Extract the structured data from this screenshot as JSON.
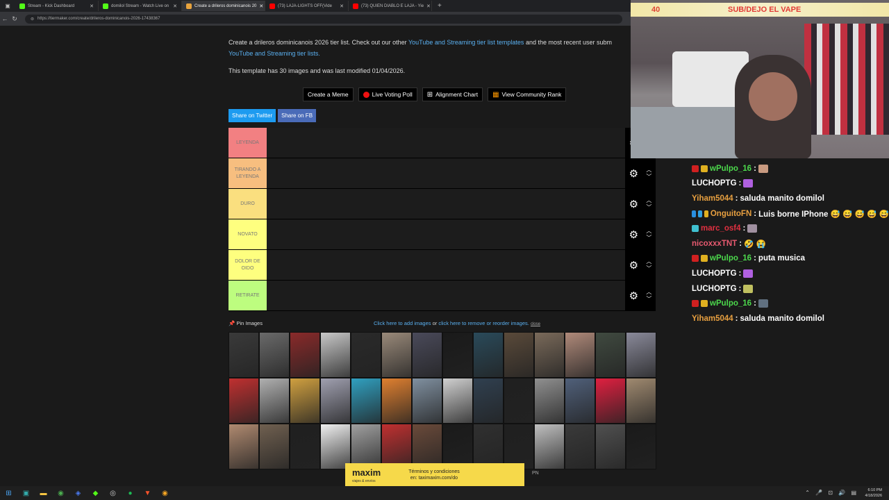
{
  "browser": {
    "tabs": [
      {
        "title": "Stream - Kick Dashboard",
        "color": "#53fc18",
        "active": false
      },
      {
        "title": "domilol Stream - Watch Live on",
        "color": "#53fc18",
        "active": false
      },
      {
        "title": "Create a drileros dominicanois 20",
        "color": "#e8a33d",
        "active": true
      },
      {
        "title": "(73) LAJA-LIGHTS OFF(Vide",
        "color": "#ff0000",
        "active": false
      },
      {
        "title": "(73) QUIEN DIABLO E LAJA - Yie",
        "color": "#ff0000",
        "active": false
      }
    ],
    "new_tab": "+",
    "url": "https://tiermaker.com/create/drileros-dominicanois-2026-17438367"
  },
  "page": {
    "intro_pre": "Create a drileros dominicanois 2026 tier list. Check out our other",
    "intro_link1": "YouTube and Streaming tier list templates",
    "intro_mid": "and the most recent user subm",
    "intro_link2": "YouTube and Streaming tier lists.",
    "modified": "This template has 30 images and was last modified 01/04/2026.",
    "actions": {
      "meme": "Create a Meme",
      "poll": "Live Voting Poll",
      "alignment": "Alignment Chart",
      "community": "View Community Rank"
    },
    "share_twitter": "Share on Twitter",
    "share_fb": "Share on FB",
    "tiers": [
      {
        "label": "LEYENDA",
        "color": "#f28082"
      },
      {
        "label": "TIRANDO A LEYENDA",
        "color": "#f7be7f"
      },
      {
        "label": "DURO",
        "color": "#fadf7f"
      },
      {
        "label": "NOVATO",
        "color": "#feff7f"
      },
      {
        "label": "DOLOR DE OIDO",
        "color": "#feff7f"
      },
      {
        "label": "RETIRATE",
        "color": "#bdfd7f"
      }
    ],
    "pin_images": "Pin Images",
    "add_images": "Click here to add images",
    "or": "or",
    "remove_images": "click here to remove or reorder images.",
    "close": "close"
  },
  "ad": {
    "brand": "maxim",
    "tagline": "viajes & envíos",
    "line1": "Términos y condiciones",
    "line2": "en: taximaxim.com/do",
    "pn": "PN"
  },
  "webcam": {
    "count": "40",
    "banner": "SUB/DEJO EL VAPE"
  },
  "chat": [
    {
      "user": "wPulpo_16",
      "color": "#4cd84c",
      "text": "",
      "badges": [
        "#d02020",
        "#e0b020"
      ],
      "emote": "#c89a80"
    },
    {
      "user": "LUCHOPTG",
      "color": "#ffffff",
      "text": "",
      "badges": [],
      "emote": "#b060e0"
    },
    {
      "user": "Yiham5044",
      "color": "#e8a040",
      "text": "saluda manito domilol",
      "badges": [],
      "emote": ""
    },
    {
      "user": "OnguitoFN",
      "color": "#e8a040",
      "text": "Luis borne IPhone 😅 😅 😅 😅 😅",
      "badges": [
        "#2a90e0",
        "#30a0e0",
        "#e0b020"
      ],
      "emote": ""
    },
    {
      "user": "marc_osf4",
      "color": "#e03040",
      "text": "",
      "badges": [
        "#40c0d0"
      ],
      "emote": "#a090a0"
    },
    {
      "user": "nicoxxxTNT",
      "color": "#e85a70",
      "text": "🤣 😭",
      "badges": [],
      "emote": ""
    },
    {
      "user": "wPulpo_16",
      "color": "#4cd84c",
      "text": "puta musica",
      "badges": [
        "#d02020",
        "#e0b020"
      ],
      "emote": ""
    },
    {
      "user": "LUCHOPTG",
      "color": "#ffffff",
      "text": "",
      "badges": [],
      "emote": "#b060e0"
    },
    {
      "user": "LUCHOPTG",
      "color": "#ffffff",
      "text": "",
      "badges": [],
      "emote": "#c0c060"
    },
    {
      "user": "wPulpo_16",
      "color": "#4cd84c",
      "text": "",
      "badges": [
        "#d02020",
        "#e0b020"
      ],
      "emote": "#607080"
    },
    {
      "user": "Yiham5044",
      "color": "#e8a040",
      "text": "saluda manito domilol",
      "badges": [],
      "emote": ""
    }
  ],
  "taskbar": {
    "time": "6:10 PM",
    "date": "4/18/2026"
  }
}
